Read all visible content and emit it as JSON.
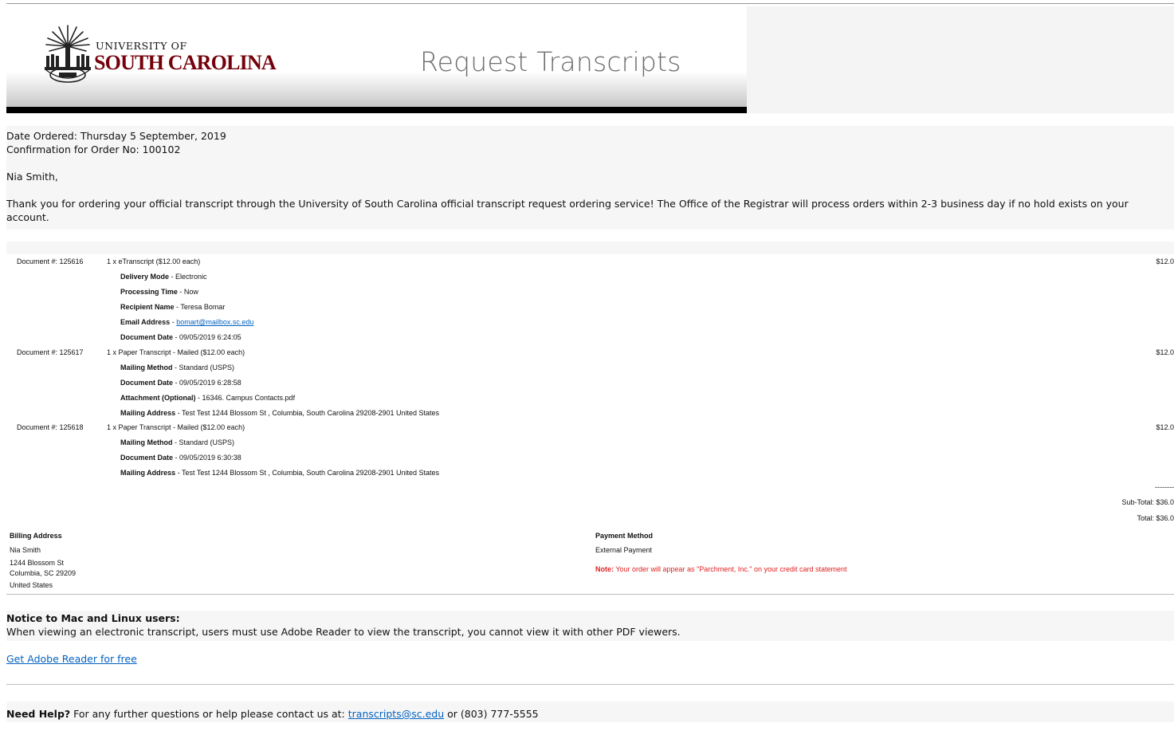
{
  "header": {
    "logo_university_of": "UNIVERSITY OF",
    "logo_south_carolina": "SOUTH CAROLINA",
    "title": "Request Transcripts"
  },
  "order": {
    "date_ordered": "Date Ordered: Thursday 5 September, 2019",
    "confirmation": "Confirmation for Order No: 100102",
    "greeting": "Nia Smith,",
    "thank_you": "Thank you for ordering your official transcript through the University of South Carolina official transcript request ordering service! The Office of the Registrar will process orders within 2-3 business day if no hold exists on your account."
  },
  "documents": [
    {
      "doc_number": "Document #: 125616",
      "item": "1 x eTranscript ($12.00 each)",
      "price": "$12.0",
      "details": [
        {
          "label": "Delivery Mode",
          "value": " - Electronic"
        },
        {
          "label": "Processing Time",
          "value": " - Now"
        },
        {
          "label": "Recipient Name",
          "value": " - Teresa Bomar"
        },
        {
          "label": "Email Address",
          "value": " - ",
          "link": "bomart@mailbox.sc.edu"
        },
        {
          "label": "Document Date",
          "value": " - 09/05/2019 6:24:05"
        }
      ]
    },
    {
      "doc_number": "Document #: 125617",
      "item": "1 x Paper Transcript - Mailed ($12.00 each)",
      "price": "$12.0",
      "details": [
        {
          "label": "Mailing Method",
          "value": " - Standard (USPS)"
        },
        {
          "label": "Document Date",
          "value": " - 09/05/2019 6:28:58"
        },
        {
          "label": "Attachment (Optional)",
          "value": " - 16346. Campus Contacts.pdf"
        },
        {
          "label": "Mailing Address",
          "value": " - Test Test 1244 Blossom St , Columbia, South Carolina 29208-2901 United States"
        }
      ]
    },
    {
      "doc_number": "Document #: 125618",
      "item": "1 x Paper Transcript - Mailed ($12.00 each)",
      "price": "$12.0",
      "details": [
        {
          "label": "Mailing Method",
          "value": " - Standard (USPS)"
        },
        {
          "label": "Document Date",
          "value": " - 09/05/2019 6:30:38"
        },
        {
          "label": "Mailing Address",
          "value": " - Test Test 1244 Blossom St , Columbia, South Carolina 29208-2901 United States"
        }
      ]
    }
  ],
  "totals": {
    "dashes": "--------",
    "subtotal": "Sub-Total: $36.0",
    "total": "Total: $36.0"
  },
  "billing": {
    "heading": "Billing Address",
    "lines": [
      "Nia Smith",
      "1244 Blossom St",
      "Columbia, SC 29209",
      "United States"
    ]
  },
  "payment": {
    "heading": "Payment Method",
    "method": "External Payment",
    "note_label": "Note:",
    "note_text": " Your order will appear as \"Parchment, Inc.\" on your credit card statement"
  },
  "notice": {
    "heading": "Notice to Mac and Linux users:",
    "text": "When viewing an electronic transcript, users must use Adobe Reader to view the transcript, you cannot view it with other PDF viewers.",
    "link": "Get Adobe Reader for free"
  },
  "help": {
    "label": "Need Help?",
    "text": " For any further questions or help please contact us at: ",
    "email": "transcripts@sc.edu",
    "phone": " or (803) 777-5555"
  },
  "colors": {
    "brand_garnet": "#73000a",
    "link_blue": "#0563c1",
    "note_red": "#e02020"
  }
}
